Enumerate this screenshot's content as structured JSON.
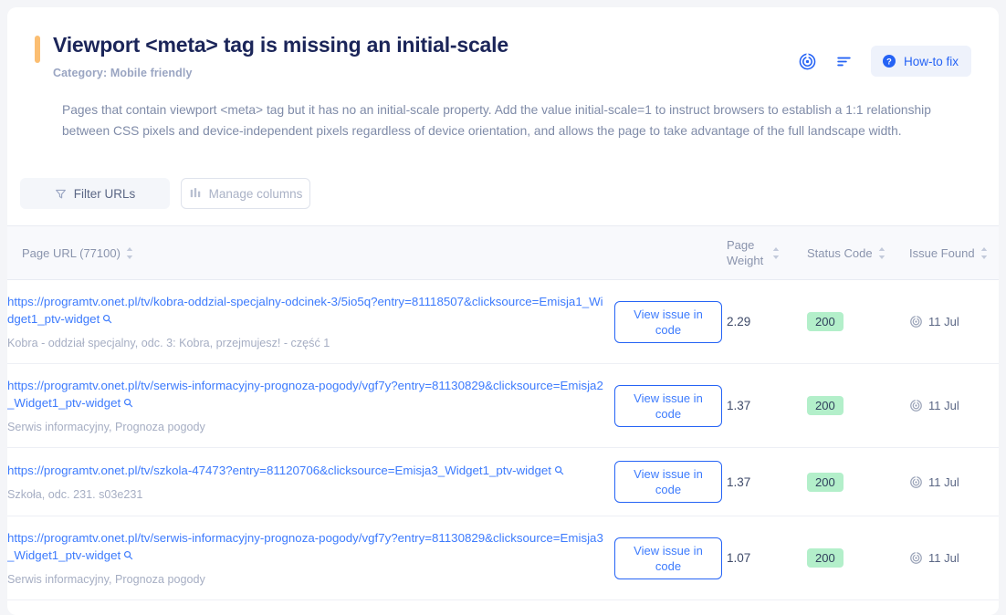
{
  "header": {
    "title": "Viewport <meta> tag is missing an initial-scale",
    "category": "Category: Mobile friendly",
    "description": "Pages that contain viewport <meta> tag but it has no an initial-scale property. Add the value initial-scale=1 to instruct browsers to establish a 1:1 relationship between CSS pixels and device-independent pixels regardless of device orientation, and allows the page to take advantage of the full landscape width.",
    "actions": {
      "radar_icon": "radar-icon",
      "sort_icon": "sort-icon",
      "howto_label": "How-to fix",
      "howto_icon": "question-circle-icon"
    },
    "accent_color": "#fbbe72"
  },
  "toolbar": {
    "filter_label": "Filter URLs",
    "filter_icon": "funnel-icon",
    "columns_label": "Manage columns",
    "columns_icon": "columns-icon"
  },
  "table": {
    "columns": [
      {
        "label": "Page URL (77100)",
        "sortable": true
      },
      {
        "label": "",
        "sortable": false
      },
      {
        "label": "Page Weight",
        "sortable": true
      },
      {
        "label": "Status Code",
        "sortable": true
      },
      {
        "label": "Issue Found",
        "sortable": true
      }
    ],
    "action_label": "View issue in code",
    "rows": [
      {
        "url": "https://programtv.onet.pl/tv/kobra-oddzial-specjalny-odcinek-3/5io5q?entry=81118507&clicksource=Emisja1_Widget1_ptv-widget",
        "subtitle": "Kobra - oddział specjalny, odc. 3: Kobra, przejmujesz! - część 1",
        "page_weight": "2.29",
        "status_code": "200",
        "issue_found": "11 Jul"
      },
      {
        "url": "https://programtv.onet.pl/tv/serwis-informacyjny-prognoza-pogody/vgf7y?entry=81130829&clicksource=Emisja2_Widget1_ptv-widget",
        "subtitle": "Serwis informacyjny, Prognoza pogody",
        "page_weight": "1.37",
        "status_code": "200",
        "issue_found": "11 Jul"
      },
      {
        "url": "https://programtv.onet.pl/tv/szkola-47473?entry=81120706&clicksource=Emisja3_Widget1_ptv-widget",
        "subtitle": "Szkoła, odc. 231. s03e231",
        "page_weight": "1.37",
        "status_code": "200",
        "issue_found": "11 Jul"
      },
      {
        "url": "https://programtv.onet.pl/tv/serwis-informacyjny-prognoza-pogody/vgf7y?entry=81130829&clicksource=Emisja3_Widget1_ptv-widget",
        "subtitle": "Serwis informacyjny, Prognoza pogody",
        "page_weight": "1.07",
        "status_code": "200",
        "issue_found": "11 Jul"
      }
    ],
    "magnifier_icon": "magnifier-icon",
    "issue_found_icon": "radar-icon",
    "status_badge_color": "#b3efca"
  }
}
